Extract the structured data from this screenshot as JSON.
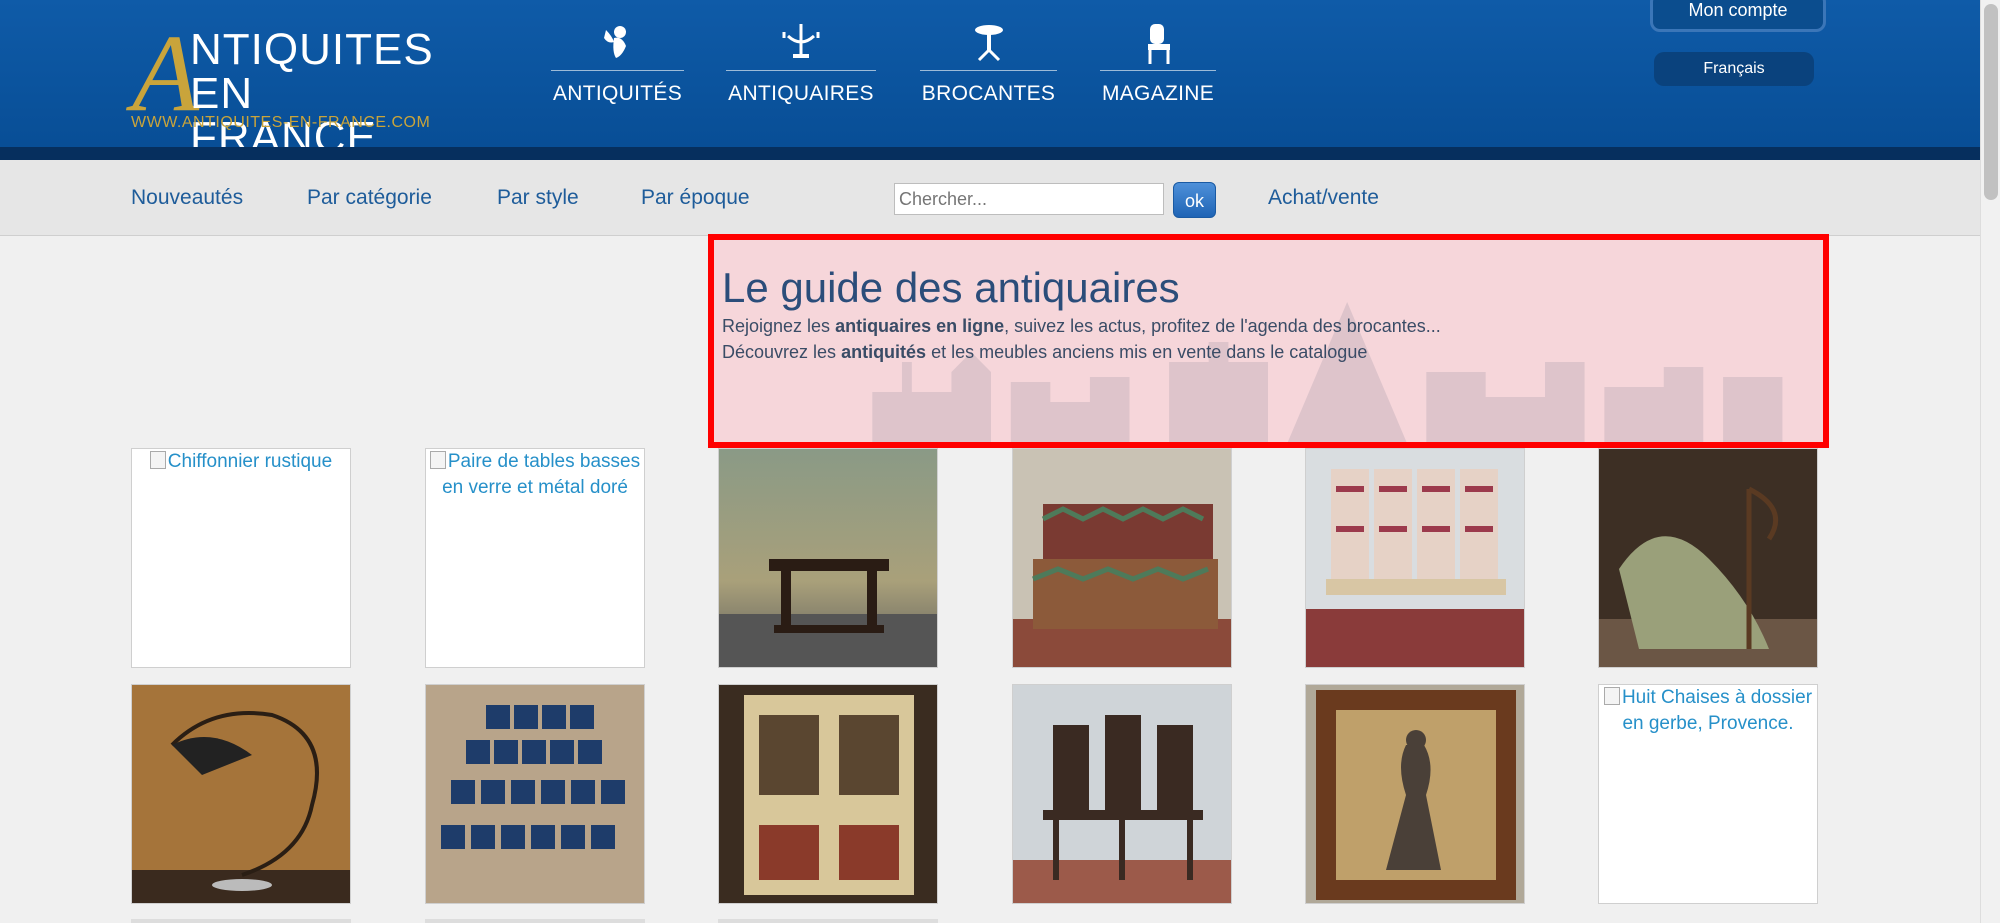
{
  "header": {
    "logo": {
      "letter": "A",
      "line1": "NTIQUITES",
      "line2": "EN FRANCE",
      "url": "WWW.ANTIQUITES-EN-FRANCE.COM"
    },
    "nav": [
      {
        "label": "ANTIQUITÉS",
        "icon": "cherub-icon"
      },
      {
        "label": "ANTIQUAIRES",
        "icon": "candelabra-icon"
      },
      {
        "label": "BROCANTES",
        "icon": "side-table-icon"
      },
      {
        "label": "MAGAZINE",
        "icon": "chair-icon"
      }
    ],
    "account_label": "Mon compte",
    "language_label": "Français"
  },
  "subnav": {
    "links": [
      "Nouveautés",
      "Par catégorie",
      "Par style",
      "Par époque"
    ],
    "search_placeholder": "Chercher...",
    "search_button": "ok",
    "sell_link": "Achat/vente"
  },
  "hero": {
    "title": "Le guide des antiquaires",
    "line1_pre": "Rejoignez les ",
    "line1_bold": "antiquaires en ligne",
    "line1_post": ", suivez les actus, profitez de l'agenda des brocantes...",
    "line2_pre": "Découvrez les ",
    "line2_bold": "antiquités",
    "line2_post": " et les meubles anciens mis en vente dans le catalogue"
  },
  "products": [
    {
      "alt": "Chiffonnier rustique",
      "broken": true
    },
    {
      "alt": "Paire de tables basses en verre et métal doré",
      "broken": true
    },
    {
      "alt": "",
      "broken": false,
      "photo": "console-table"
    },
    {
      "alt": "",
      "broken": false,
      "photo": "armchair"
    },
    {
      "alt": "",
      "broken": false,
      "photo": "chairs-row"
    },
    {
      "alt": "",
      "broken": false,
      "photo": "rustic-sculpture"
    },
    {
      "alt": "",
      "broken": false,
      "photo": "arc-lamp"
    },
    {
      "alt": "",
      "broken": false,
      "photo": "pots-pyramid"
    },
    {
      "alt": "",
      "broken": false,
      "photo": "painted-cabinet"
    },
    {
      "alt": "",
      "broken": false,
      "photo": "carved-chairs"
    },
    {
      "alt": "",
      "broken": false,
      "photo": "framed-painting"
    },
    {
      "alt": "Huit Chaises à dossier en gerbe, Provence.",
      "broken": true
    }
  ],
  "colors": {
    "header_blue": "#0b55a1",
    "gold": "#c9a43b",
    "link_blue": "#1e5c9a",
    "highlight_red": "#ff0000"
  }
}
